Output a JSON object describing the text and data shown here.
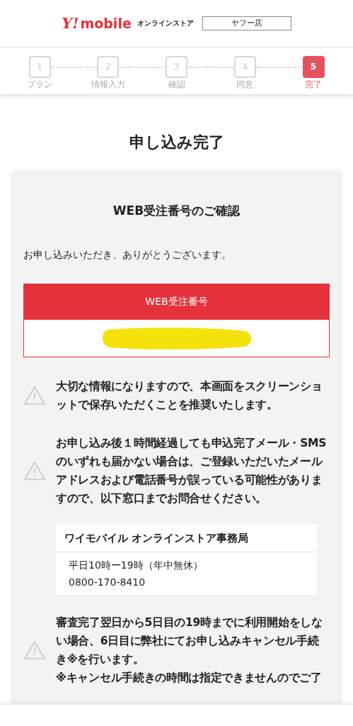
{
  "header": {
    "logo_mark": "Y!",
    "logo_word": "mobile",
    "store_label": "オンラインストア",
    "shop": "ヤフー店"
  },
  "steps": [
    {
      "number": "1",
      "label": "プラン",
      "selected": false
    },
    {
      "number": "2",
      "label": "情報入力",
      "selected": false
    },
    {
      "number": "3",
      "label": "確認",
      "selected": false
    },
    {
      "number": "4",
      "label": "同意",
      "selected": false
    },
    {
      "number": "5",
      "label": "完了",
      "selected": true
    }
  ],
  "page_title": "申し込み完了",
  "card": {
    "title": "WEB受注番号のご確認",
    "thanks": "お申し込みいただき、ありがとうございます。",
    "order_label": "WEB受注番号",
    "notices": [
      {
        "text": "大切な情報になりますので、本画面をスクリーンショットで保存いただくことを推奨いたします。"
      },
      {
        "text": "お申し込み後１時間経過しても申込完了メール・SMSのいずれも届かない場合は、ご登録いただいたメールアドレスおよび電話番号が誤っている可能性がありますので、以下窓口までお問合せください。"
      }
    ],
    "contact": {
      "name": "ワイモバイル オンラインストア事務局",
      "hours": "平日10時ー19時（年中無休）",
      "phone": "0800-170-8410"
    },
    "last_notice": [
      "審査完了翌日から5日目の19時までに利用開始をしない場合、6日目に弊社にてお申し込みキャンセル手続き※を行います。",
      "※キャンセル手続きの時間は指定できませんのでご了"
    ]
  }
}
